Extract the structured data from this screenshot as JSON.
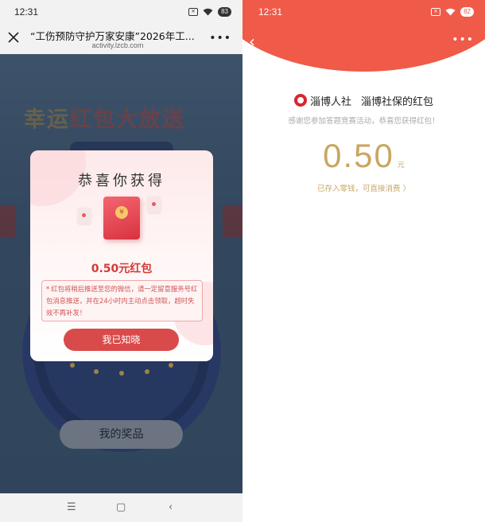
{
  "left": {
    "status": {
      "time": "12:31",
      "battery": "83"
    },
    "nav": {
      "title": "“工伤预防守护万家安康”2026年工...",
      "url": "activity.lzcb.com",
      "more": "•••"
    },
    "bg_title_part1": "幸运",
    "bg_title_part2": "红包大放送",
    "modal": {
      "title": "恭喜你获得",
      "coin": "¥",
      "amount": "0.50元红包",
      "notice": "红包将稍后推送至您的微信，请一定留意服务号红包消息推送，并在24小时内主动点击领取，超时失效不再补发！",
      "ok_label": "我已知晓"
    },
    "prize_button": "我的奖品",
    "sysnav": {
      "menu": "☰",
      "home": "▢",
      "back": "‹"
    }
  },
  "right": {
    "status": {
      "time": "12:31",
      "battery": "82"
    },
    "nav": {
      "back": "‹",
      "more": "•••"
    },
    "org_name": "淄博人社",
    "redpacket_name": "淄博社保的红包",
    "thanks": "感谢您参加答题竞赛活动，恭喜您获得红包！",
    "amount": "0.50",
    "unit": "元",
    "deposit": "已存入零钱，可直接消费 〉"
  },
  "colors": {
    "accent_red": "#f05a48",
    "modal_button": "#d94b4a",
    "gold": "#c9a762"
  }
}
